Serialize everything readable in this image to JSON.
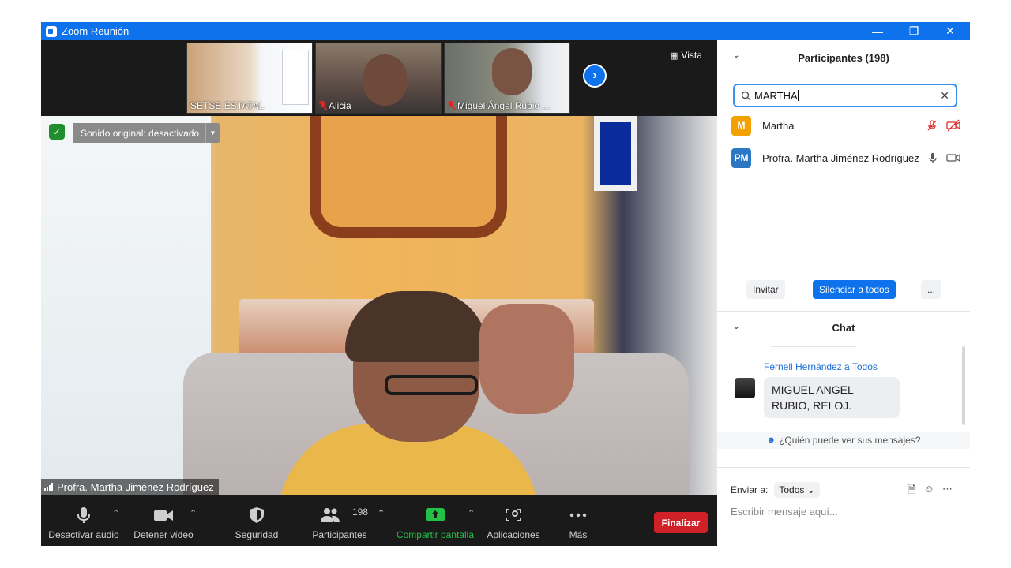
{
  "window": {
    "title": "Zoom Reunión"
  },
  "thumbnails": [
    {
      "name": "SETSE ESTATAL",
      "muted": false
    },
    {
      "name": "Alicia",
      "muted": true
    },
    {
      "name": "Miguel Ángel Rubio ...",
      "muted": true
    }
  ],
  "view_button": "Vista",
  "sound_toggle": "Sonido original: desactivado",
  "speaker_name": "Profra. Martha Jiménez Rodríguez",
  "toolbar": {
    "audio": "Desactivar audio",
    "video": "Detener vídeo",
    "security": "Seguridad",
    "participants": "Participantes",
    "participants_count": "198",
    "share": "Compartir pantalla",
    "apps": "Aplicaciones",
    "more": "Más",
    "end": "Finalizar"
  },
  "participants_panel": {
    "title": "Participantes (198)",
    "search_value": "MARTHA",
    "results": [
      {
        "initials": "M",
        "name": "Martha",
        "color": "#f2a100"
      },
      {
        "initials": "PM",
        "name": "Profra. Martha Jiménez Rodríguez",
        "color": "#2b77c4"
      }
    ],
    "invite_label": "Invitar",
    "mute_all_label": "Silenciar a todos",
    "more_label": "..."
  },
  "chat_panel": {
    "title": "Chat",
    "messages": [
      {
        "sender": "Fernell Hernández a Todos",
        "text": "MIGUEL ANGEL RUBIO, RELOJ."
      }
    ],
    "who_can_see": "¿Quién puede ver sus mensajes?",
    "send_to_label": "Enviar a:",
    "send_to_value": "Todos",
    "input_placeholder": "Escribir mensaje aquí..."
  },
  "colors": {
    "accent": "#0e72ed",
    "end": "#d12128",
    "share": "#22c247"
  }
}
